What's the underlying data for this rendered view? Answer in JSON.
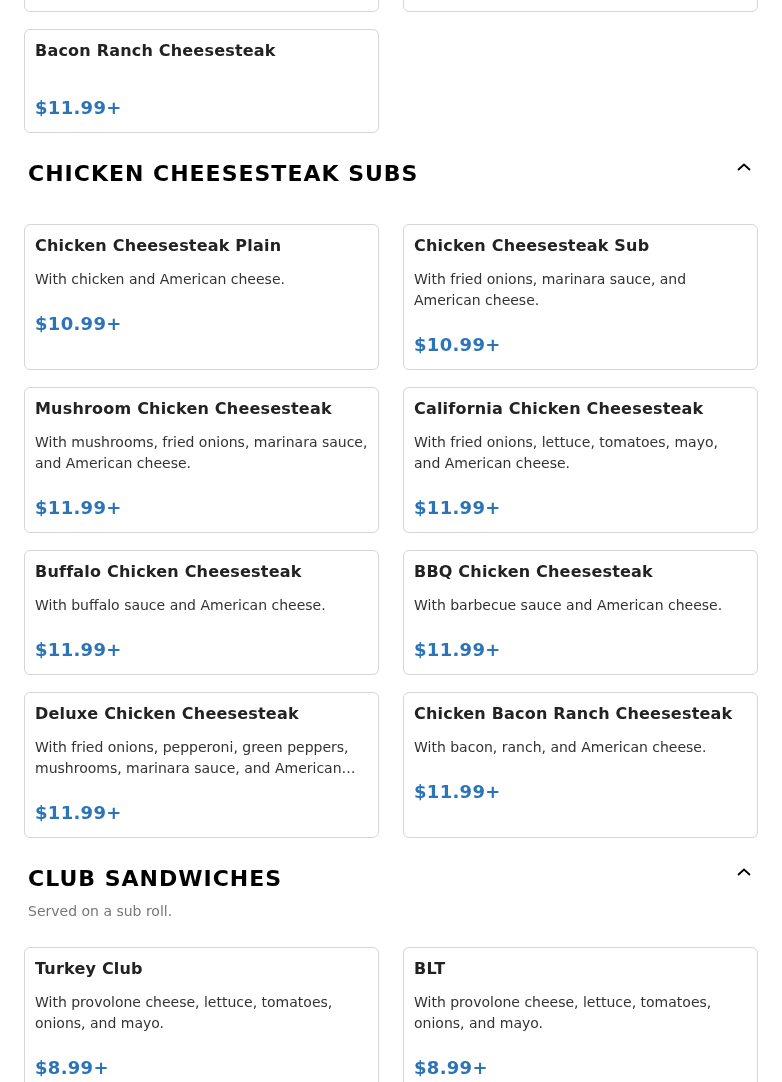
{
  "sections": [
    {
      "items": [
        {
          "kind": "cut-off"
        },
        {
          "kind": "cut-off"
        },
        {
          "kind": "full",
          "title": "Bacon Ranch Cheesesteak",
          "price": "$11.99+"
        }
      ]
    },
    {
      "title": "CHICKEN CHEESESTEAK SUBS",
      "expanded": true,
      "items": [
        {
          "title": "Chicken Cheesesteak Plain",
          "description": "With chicken and American cheese.",
          "price": "$10.99+"
        },
        {
          "title": "Chicken Cheesesteak Sub",
          "description": "With fried onions, marinara sauce, and American cheese.",
          "price": "$10.99+"
        },
        {
          "title": "Mushroom Chicken Cheesesteak",
          "description": "With mushrooms, fried onions, marinara sauce, and American cheese.",
          "price": "$11.99+"
        },
        {
          "title": "California Chicken Cheesesteak",
          "description": "With fried onions, lettuce, tomatoes, mayo, and American cheese.",
          "price": "$11.99+"
        },
        {
          "title": "Buffalo Chicken Cheesesteak",
          "description": "With buffalo sauce and American cheese.",
          "price": "$11.99+"
        },
        {
          "title": "BBQ Chicken Cheesesteak",
          "description": "With barbecue sauce and American cheese.",
          "price": "$11.99+"
        },
        {
          "title": "Deluxe Chicken Cheesesteak",
          "description": "With fried onions, pepperoni, green peppers, mushrooms, marinara sauce, and American…",
          "price": "$11.99+"
        },
        {
          "title": "Chicken Bacon Ranch Cheesesteak",
          "description": "With bacon, ranch, and American cheese.",
          "price": "$11.99+"
        }
      ]
    },
    {
      "title": "CLUB SANDWICHES",
      "subtitle": "Served on a sub roll.",
      "expanded": true,
      "items": [
        {
          "title": "Turkey Club",
          "description": "With provolone cheese, lettuce, tomatoes, onions, and mayo.",
          "price": "$8.99+"
        },
        {
          "title": "BLT",
          "description": "With provolone cheese, lettuce, tomatoes, onions, and mayo.",
          "price": "$8.99+"
        }
      ]
    }
  ]
}
